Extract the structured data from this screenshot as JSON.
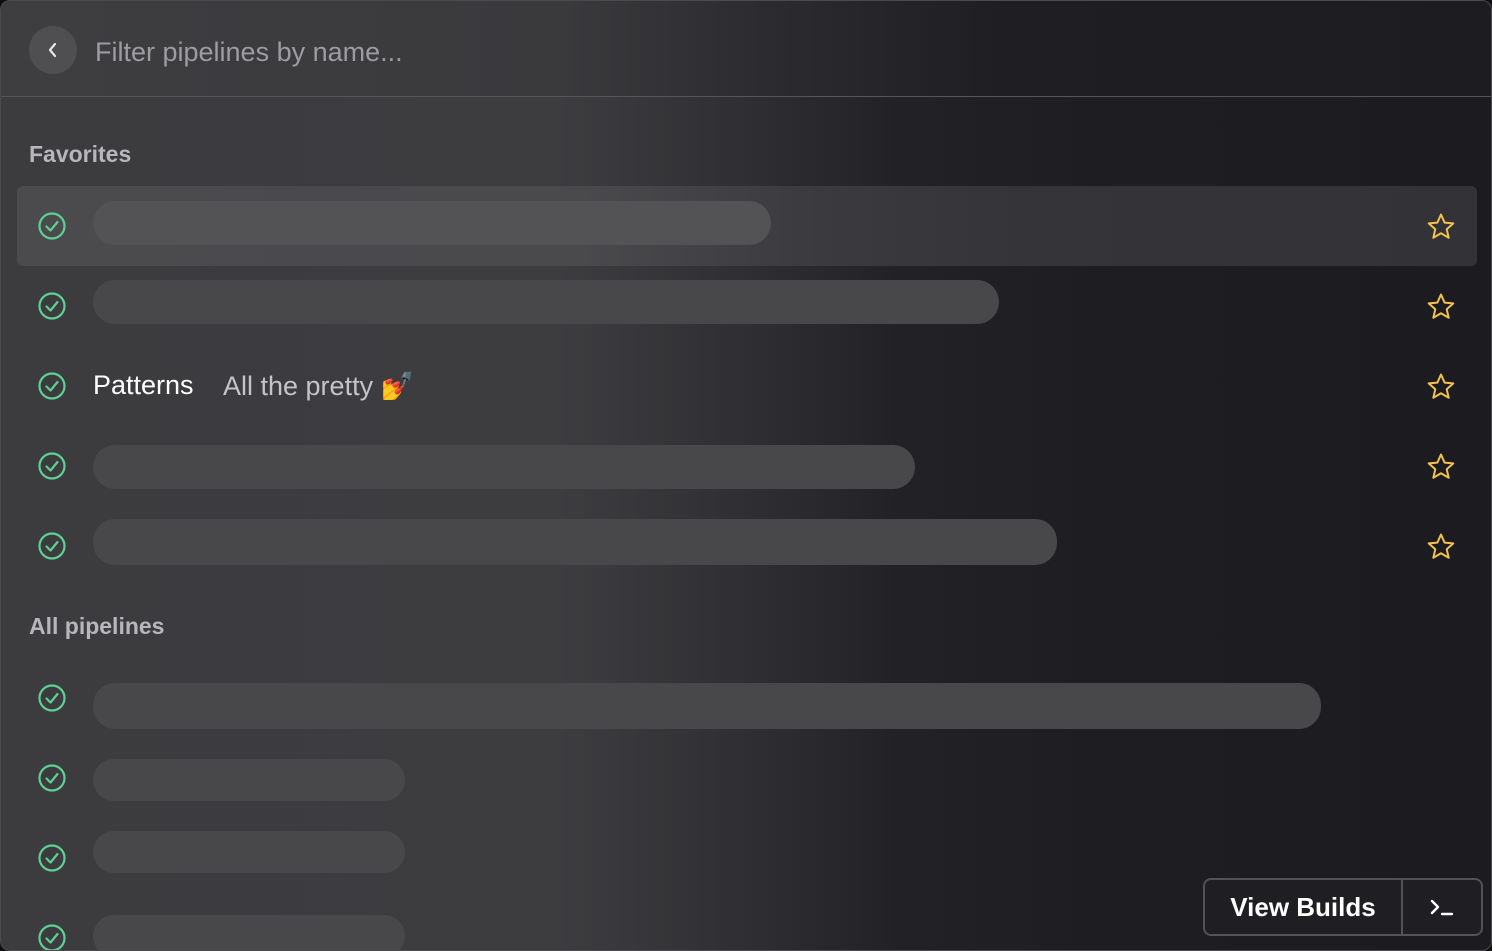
{
  "search": {
    "placeholder": "Filter pipelines by name..."
  },
  "sections": {
    "favorites_label": "Favorites",
    "all_label": "All pipelines"
  },
  "favorites": [
    {
      "status": "passed",
      "redacted": true,
      "starred": true
    },
    {
      "status": "passed",
      "redacted": true,
      "starred": true
    },
    {
      "status": "passed",
      "redacted": false,
      "name": "Patterns",
      "description": "All the pretty 💅",
      "starred": true
    },
    {
      "status": "passed",
      "redacted": true,
      "starred": true
    },
    {
      "status": "passed",
      "redacted": true,
      "starred": true
    }
  ],
  "all_pipelines": [
    {
      "status": "passed",
      "redacted": true
    },
    {
      "status": "passed",
      "redacted": true
    },
    {
      "status": "passed",
      "redacted": true
    },
    {
      "status": "passed",
      "redacted": true
    }
  ],
  "patterns": {
    "name": "Patterns",
    "description": "All the pretty 💅"
  },
  "actions": {
    "view_builds": "View Builds",
    "terminal_icon": "terminal-icon"
  },
  "colors": {
    "status_passed": "#5fcf93",
    "star": "#f2c14e"
  }
}
